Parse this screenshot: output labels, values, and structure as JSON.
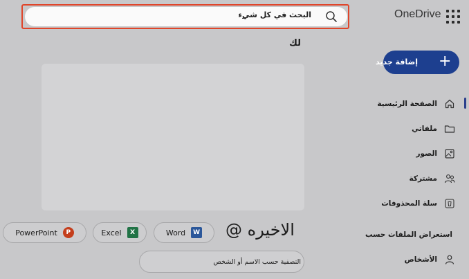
{
  "app": {
    "brand": "OneDrive"
  },
  "search": {
    "placeholder": "البحث في كل شيء"
  },
  "main": {
    "for_you_title": "لك",
    "recent_title": "الاخيره @",
    "filter_placeholder": "التصفية حسب الاسم أو الشخص",
    "file_types": [
      {
        "label": "Word",
        "icon": "word-icon",
        "color": "#2b579a",
        "letter": "W"
      },
      {
        "label": "Excel",
        "icon": "excel-icon",
        "color": "#217346",
        "letter": "X"
      },
      {
        "label": "PowerPoint",
        "icon": "powerpoint-icon",
        "color": "#c43e1c",
        "letter": "P"
      }
    ]
  },
  "sidebar": {
    "new_button": "إضافة جديد",
    "items": [
      {
        "label": "الصفحة الرئيسية",
        "icon": "home-icon",
        "active": true
      },
      {
        "label": "ملفاتي",
        "icon": "folder-icon"
      },
      {
        "label": "الصور",
        "icon": "image-icon"
      },
      {
        "label": "مشتركة",
        "icon": "people-icon"
      },
      {
        "label": "سلة المحذوفات",
        "icon": "recycle-bin-icon"
      }
    ],
    "browse_label": "استعراض الملفات حسب",
    "browse_items": [
      {
        "label": "الأشخاص",
        "icon": "person-icon"
      }
    ]
  },
  "colors": {
    "accent": "#1d3f8f",
    "highlight": "#e0452a"
  }
}
